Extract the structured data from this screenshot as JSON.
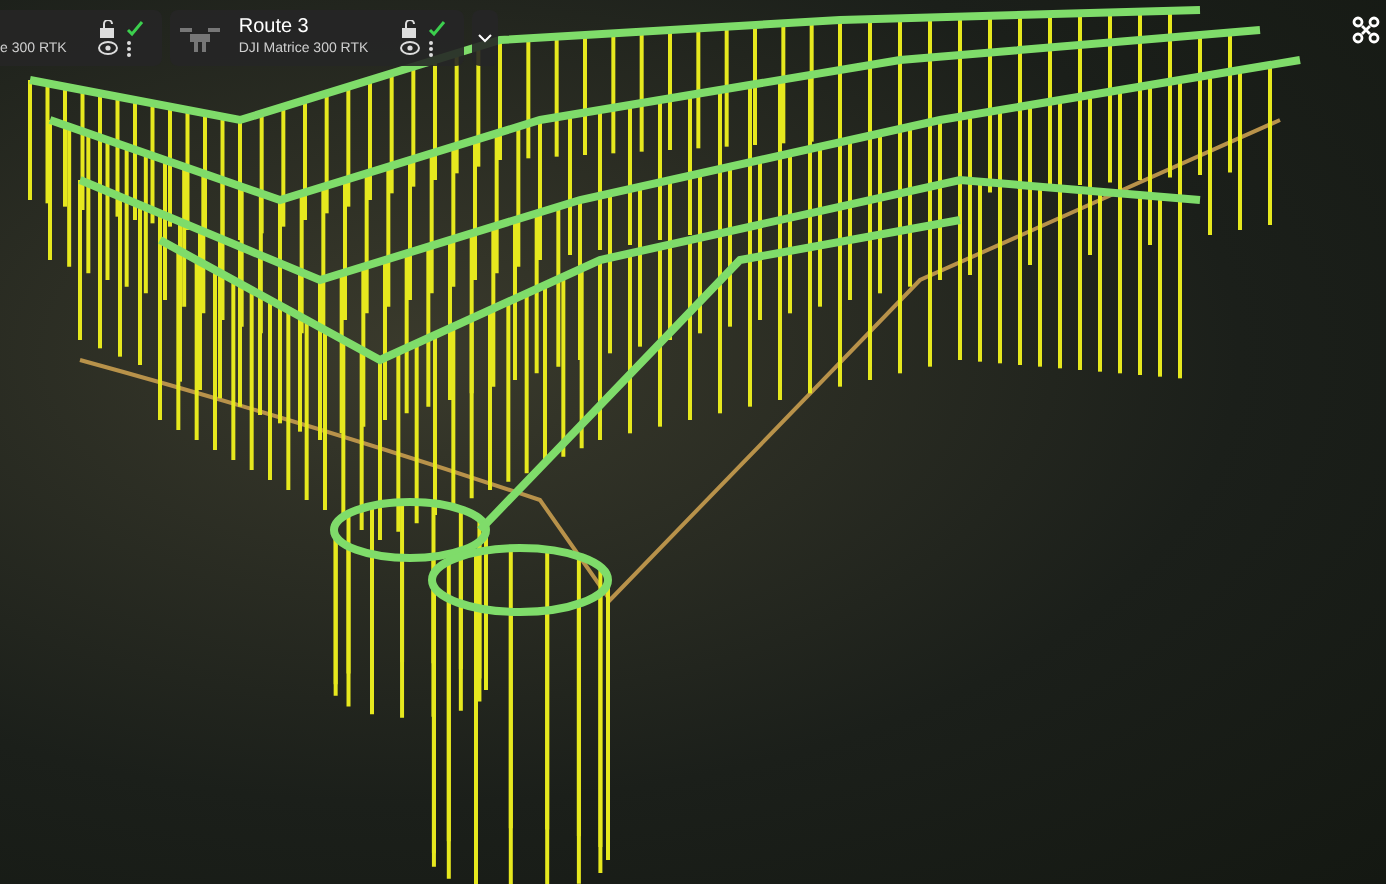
{
  "route_cards": [
    {
      "subtitle": "e 300 RTK",
      "has_thumbnail": false
    },
    {
      "title": "Route 3",
      "subtitle": "DJI Matrice 300 RTK",
      "has_thumbnail": true
    }
  ]
}
